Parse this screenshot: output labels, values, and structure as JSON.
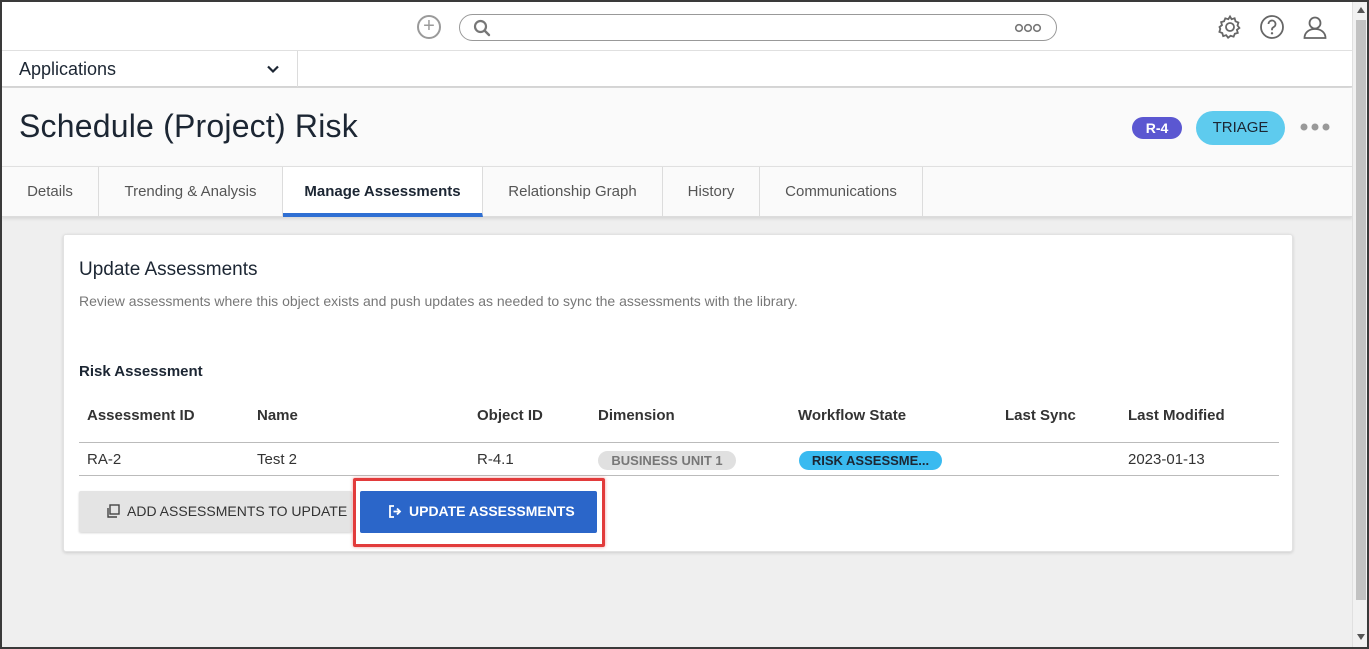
{
  "search": {
    "placeholder": ""
  },
  "topbar": {
    "add_icon": "plus-circle-icon",
    "settings_icon": "gear-icon",
    "help_icon": "question-circle-icon",
    "profile_icon": "user-icon"
  },
  "appbar": {
    "label": "Applications"
  },
  "header": {
    "title": "Schedule (Project) Risk",
    "id_badge": "R-4",
    "state_badge": "TRIAGE",
    "colors": {
      "id_badge": "#5b57d1",
      "state_badge": "#5ecbee"
    }
  },
  "tabs": [
    {
      "label": "Details"
    },
    {
      "label": "Trending & Analysis"
    },
    {
      "label": "Manage Assessments"
    },
    {
      "label": "Relationship Graph"
    },
    {
      "label": "History"
    },
    {
      "label": "Communications"
    }
  ],
  "active_tab": "Manage Assessments",
  "card": {
    "title": "Update Assessments",
    "description": "Review assessments where this object exists and push updates as needed to sync the assessments with the library.",
    "section_title": "Risk Assessment",
    "columns": [
      "Assessment ID",
      "Name",
      "Object ID",
      "Dimension",
      "Workflow State",
      "Last Sync",
      "Last Modified"
    ],
    "rows": [
      {
        "assessment_id": "RA-2",
        "name": "Test 2",
        "object_id": "R-4.1",
        "dimension": "BUSINESS UNIT 1",
        "workflow_state": "RISK ASSESSME...",
        "last_sync": "",
        "last_modified": "2023-01-13"
      }
    ],
    "add_button": "ADD ASSESSMENTS TO UPDATE",
    "update_button": "UPDATE ASSESSMENTS",
    "colors": {
      "primary": "#2b66c9",
      "highlight": "#e23b3b"
    }
  }
}
